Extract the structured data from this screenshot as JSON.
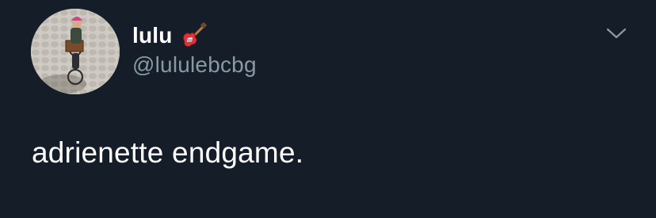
{
  "tweet": {
    "user": {
      "display_name": "lulu",
      "handle": "@lululebcbg",
      "name_emoji": "guitar-icon"
    },
    "text": "adrienette endgame.",
    "menu_icon": "chevron-down-icon"
  },
  "colors": {
    "background": "#151d28",
    "text_primary": "#ffffff",
    "text_secondary": "#8899a6"
  }
}
